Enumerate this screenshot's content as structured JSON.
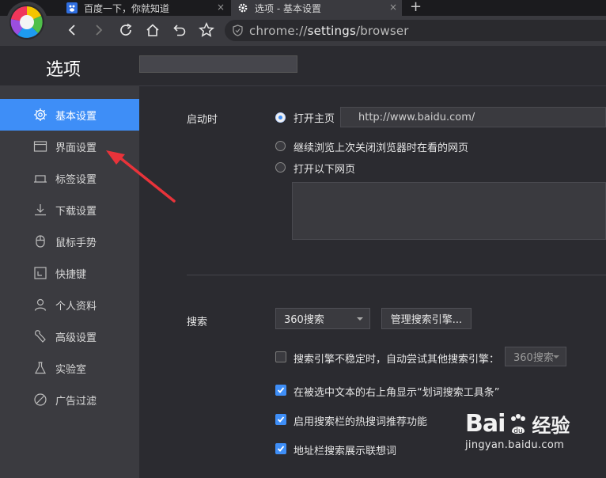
{
  "tabs": [
    {
      "title": "百度一下，你就知道",
      "close": "×"
    },
    {
      "title": "选项 - 基本设置",
      "close": "×"
    }
  ],
  "new_tab_label": "+",
  "address": {
    "scheme": "chrome://",
    "host": "settings",
    "path": "/browser"
  },
  "page_title": "选项",
  "sidebar": {
    "items": [
      {
        "label": "基本设置",
        "icon": "gear-icon"
      },
      {
        "label": "界面设置",
        "icon": "window-icon"
      },
      {
        "label": "标签设置",
        "icon": "tab-icon"
      },
      {
        "label": "下载设置",
        "icon": "download-icon"
      },
      {
        "label": "鼠标手势",
        "icon": "mouse-icon"
      },
      {
        "label": "快捷键",
        "icon": "shortcut-icon"
      },
      {
        "label": "个人资料",
        "icon": "person-icon"
      },
      {
        "label": "高级设置",
        "icon": "wrench-icon"
      },
      {
        "label": "实验室",
        "icon": "flask-icon"
      },
      {
        "label": "广告过滤",
        "icon": "block-icon"
      }
    ]
  },
  "startup": {
    "label": "启动时",
    "options": [
      {
        "label": "打开主页",
        "checked": true
      },
      {
        "label": "继续浏览上次关闭浏览器时在看的网页",
        "checked": false
      },
      {
        "label": "打开以下网页",
        "checked": false
      }
    ],
    "homepage_url": "http://www.baidu.com/"
  },
  "search": {
    "label": "搜索",
    "engine": "360搜索",
    "manage_button": "管理搜索引擎...",
    "options": [
      {
        "label": "搜索引擎不稳定时，自动尝试其他搜索引擎：",
        "checked": false
      },
      {
        "label": "在被选中文本的右上角显示“划词搜索工具条”",
        "checked": true
      },
      {
        "label": "启用搜索栏的热搜词推荐功能",
        "checked": true
      },
      {
        "label": "地址栏搜索展示联想词",
        "checked": true
      }
    ],
    "fallback_engine": "360搜索"
  },
  "watermark": {
    "brand": "Bai",
    "brand2": "经验",
    "site": "jingyan.baidu.com"
  },
  "colors": {
    "accent": "#3e8ef7",
    "annotation_arrow": "#e8333a"
  }
}
